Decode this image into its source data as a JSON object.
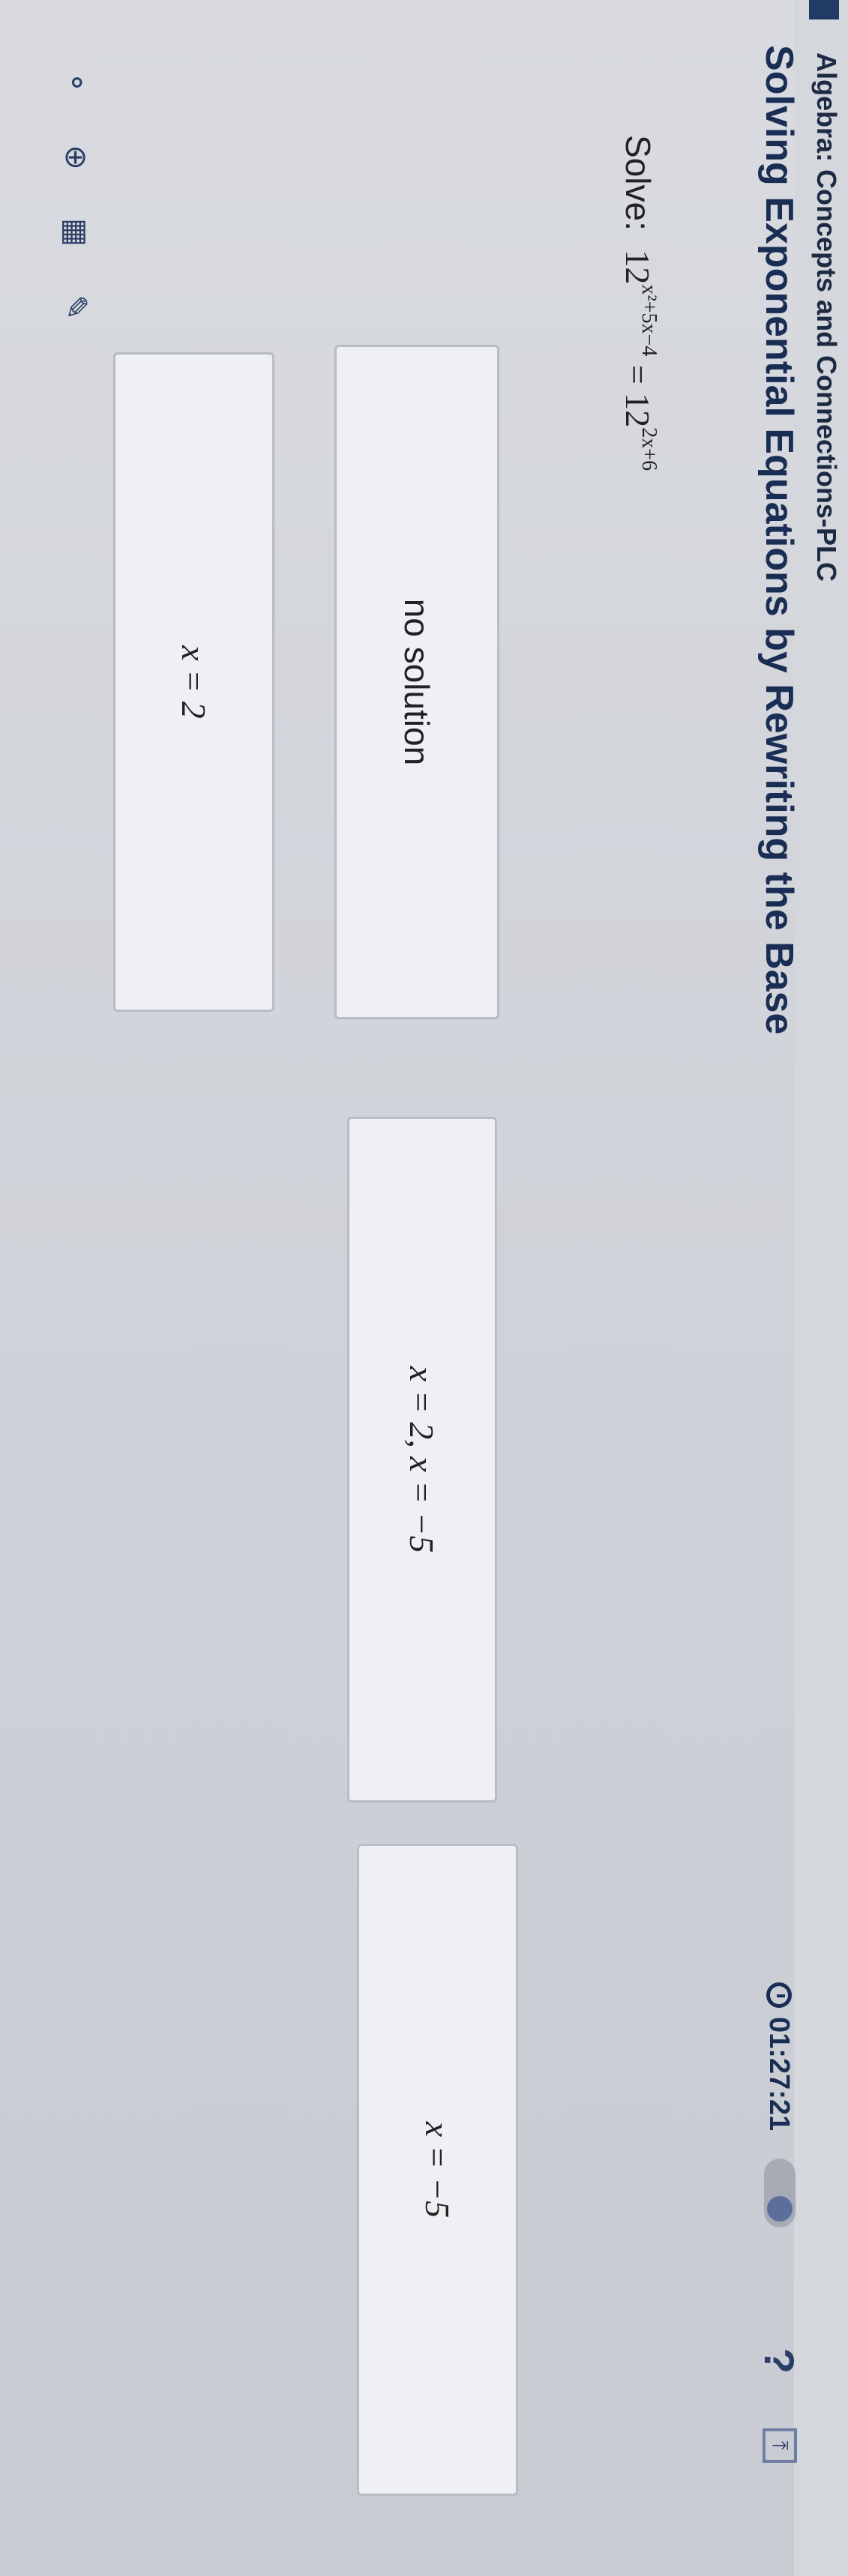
{
  "header": {
    "course": "Algebra: Concepts and Connections-PLC",
    "lesson_title": "Solving Exponential Equations by Rewriting the Base",
    "timer": "01:27:21"
  },
  "question": {
    "label": "Solve:",
    "base_left": "12",
    "exp_left": "x²+5x−4",
    "equals": " = ",
    "base_right": "12",
    "exp_right": "2x+6"
  },
  "answers": [
    {
      "text": "no solution"
    },
    {
      "text": "x = 2, x = −5"
    },
    {
      "text": "x = −5"
    },
    {
      "text": "x = 2"
    }
  ],
  "icons": {
    "menu": "menu-icon",
    "timer": "clock-icon",
    "help": "help-icon",
    "expand": "expand-icon",
    "calculator": "calculator-icon",
    "globe": "globe-icon",
    "draw": "drawing-tool-icon",
    "accessibility": "accessibility-icon"
  },
  "colors": {
    "title": "#1a2e55",
    "answer_bg": "#eef0f3",
    "answer_border": "#b9bcc4"
  }
}
